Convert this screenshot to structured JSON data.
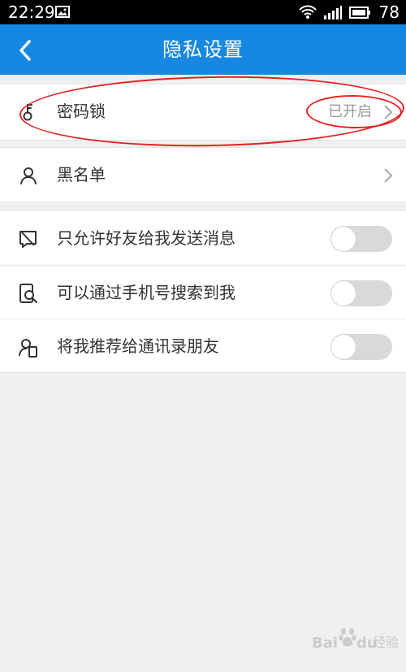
{
  "colors": {
    "status_bar": "#000000",
    "accent": "#1788e2",
    "background": "#eff1f0",
    "annotation": "#e32222"
  },
  "status_bar": {
    "time": "22:29",
    "image_icon": "image-icon",
    "wifi_icon": "wifi-icon",
    "signal_icon": "signal-icon",
    "battery_icon": "battery-icon",
    "battery": "78"
  },
  "nav": {
    "back_icon": "chevron-left-icon",
    "title": "隐私设置"
  },
  "sections": {
    "password": {
      "icon": "key-icon",
      "label": "密码锁",
      "value": "已开启",
      "chevron": "chevron-right-icon"
    },
    "blacklist": {
      "icon": "user-icon",
      "label": "黑名单",
      "chevron": "chevron-right-icon"
    },
    "privacy_options": [
      {
        "icon": "message-block-icon",
        "label": "只允许好友给我发送消息",
        "toggle": false
      },
      {
        "icon": "phone-search-icon",
        "label": "可以通过手机号搜索到我",
        "toggle": false
      },
      {
        "icon": "contact-phone-icon",
        "label": "将我推荐给通讯录朋友",
        "toggle": false
      }
    ]
  },
  "watermark": {
    "brand_left": "Bai",
    "brand_right": "du",
    "experience": "经验"
  }
}
